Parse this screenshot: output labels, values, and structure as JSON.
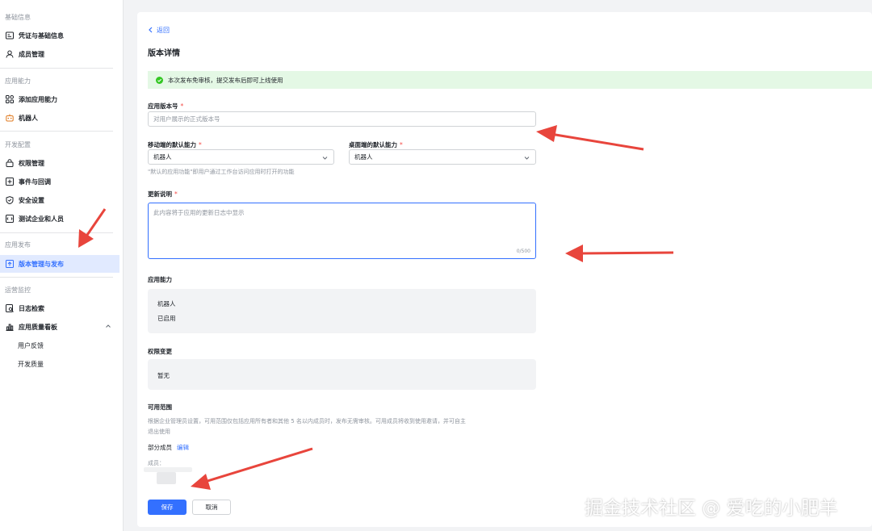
{
  "sidebar": {
    "sections": [
      "基础信息",
      "应用能力",
      "开发配置",
      "应用发布",
      "运营监控"
    ],
    "items": [
      {
        "label": "凭证与基础信息",
        "icon": "credential-icon"
      },
      {
        "label": "成员管理",
        "icon": "user-icon"
      },
      {
        "label": "添加应用能力",
        "icon": "apps-icon"
      },
      {
        "label": "机器人",
        "icon": "robot-icon"
      },
      {
        "label": "权限管理",
        "icon": "lock-icon"
      },
      {
        "label": "事件与回调",
        "icon": "event-icon"
      },
      {
        "label": "安全设置",
        "icon": "shield-icon"
      },
      {
        "label": "测试企业和人员",
        "icon": "test-icon"
      },
      {
        "label": "版本管理与发布",
        "icon": "publish-icon",
        "active": true
      },
      {
        "label": "日志检索",
        "icon": "log-search-icon"
      },
      {
        "label": "应用质量看板",
        "icon": "chart-icon",
        "expanded": true
      },
      {
        "label": "用户反馈"
      },
      {
        "label": "开发质量"
      }
    ]
  },
  "main": {
    "back_label": "返回",
    "title": "版本详情",
    "notice": "本次发布免审核，提交发布后即可上线使用",
    "version": {
      "label": "应用版本号",
      "required": "*",
      "placeholder": "对用户展示的正式版本号"
    },
    "mobile_default": {
      "label": "移动端的默认能力",
      "required": "*",
      "value": "机器人"
    },
    "desktop_default": {
      "label": "桌面端的默认能力",
      "required": "*",
      "value": "机器人"
    },
    "default_hint": "\"默认的应用功能\"即用户通过工作台访问应用时打开的功能",
    "changelog": {
      "label": "更新说明",
      "required": "*",
      "placeholder": "此内容将于应用的更新日志中显示",
      "counter": "0/500"
    },
    "capabilities": {
      "label": "应用能力",
      "name": "机器人",
      "status": "已启用"
    },
    "permissions": {
      "label": "权限变更",
      "value": "暂无"
    },
    "scope": {
      "label": "可用范围",
      "desc_line1": "根据企业管理员设置，可用范围仅包括应用所有者和其他 5 名以内成员时，发布无需审核。可用成员将收到使用邀请，并可自主",
      "desc_line2": "退出使用",
      "partial": "部分成员",
      "edit": "编辑",
      "members_label": "成员："
    },
    "save_label": "保存",
    "cancel_label": "取消"
  },
  "watermark": "掘金技术社区 @ 爱吃的小肥羊",
  "colors": {
    "accent": "#3370ff",
    "success_bg": "#e4f8e5",
    "success": "#34c724",
    "required": "#f54a45",
    "annotation_arrow": "#e8453c"
  }
}
